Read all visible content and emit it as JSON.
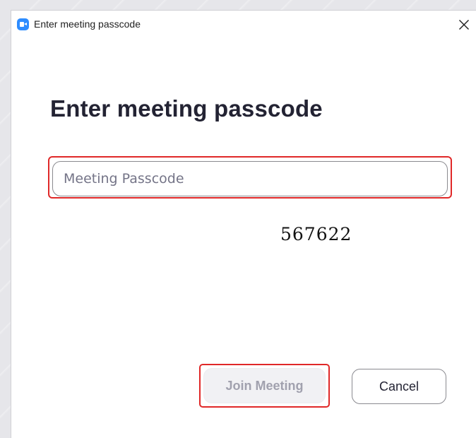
{
  "window": {
    "title": "Enter meeting passcode",
    "app_icon": "zoom-camera-icon",
    "close_icon": "close-icon"
  },
  "main": {
    "heading": "Enter meeting passcode",
    "passcode_field": {
      "value": "",
      "placeholder": "Meeting Passcode"
    },
    "passcode_annotation": "567622"
  },
  "footer": {
    "join_label": "Join Meeting",
    "join_enabled": false,
    "cancel_label": "Cancel"
  },
  "colors": {
    "highlight_outline": "#e02828",
    "brand_blue": "#2d8cff",
    "heading_text": "#232333",
    "disabled_button_bg": "#f1f1f4",
    "disabled_button_text": "#a1a1ae"
  }
}
